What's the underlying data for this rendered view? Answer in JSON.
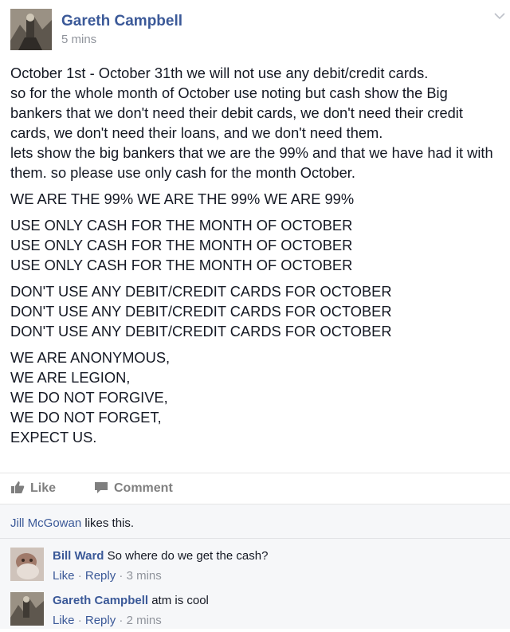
{
  "post": {
    "author": "Gareth Campbell",
    "time": "5 mins",
    "paragraphs": [
      "October 1st - October 31th we will not use any debit/credit cards.\nso for the whole month of October use noting but cash show the Big bankers that we don't need their debit cards, we don't need their credit cards, we don't need their loans, and we don't need them.\nlets show the big bankers that we are the 99% and that we have had it with them. so please use only cash for the month October.",
      "WE ARE THE 99% WE ARE THE 99% WE ARE 99%",
      "USE ONLY CASH FOR THE MONTH OF OCTOBER\nUSE ONLY CASH FOR THE MONTH OF OCTOBER\nUSE ONLY CASH FOR THE MONTH OF OCTOBER",
      "DON'T USE ANY DEBIT/CREDIT CARDS FOR OCTOBER\nDON'T USE ANY DEBIT/CREDIT CARDS FOR OCTOBER\nDON'T USE ANY DEBIT/CREDIT CARDS FOR OCTOBER",
      "WE ARE ANONYMOUS,\nWE ARE LEGION,\nWE DO NOT FORGIVE,\nWE DO NOT FORGET,\nEXPECT US."
    ]
  },
  "actions": {
    "like": "Like",
    "comment": "Comment"
  },
  "likes": {
    "name": "Jill McGowan",
    "text": " likes this."
  },
  "comments": [
    {
      "author": "Bill Ward",
      "text": "So where do we get the cash?",
      "like": "Like",
      "reply": "Reply",
      "sep": " · ",
      "time": "3 mins"
    },
    {
      "author": "Gareth Campbell",
      "text": "atm is cool",
      "like": "Like",
      "reply": "Reply",
      "sep": " · ",
      "time": "2 mins"
    }
  ],
  "colors": {
    "link": "#3b5998",
    "muted": "#90949c",
    "comment_bg": "#f6f7f9"
  },
  "icons": [
    "thumbs-up-icon",
    "comment-bubble-icon",
    "chevron-down-icon"
  ]
}
